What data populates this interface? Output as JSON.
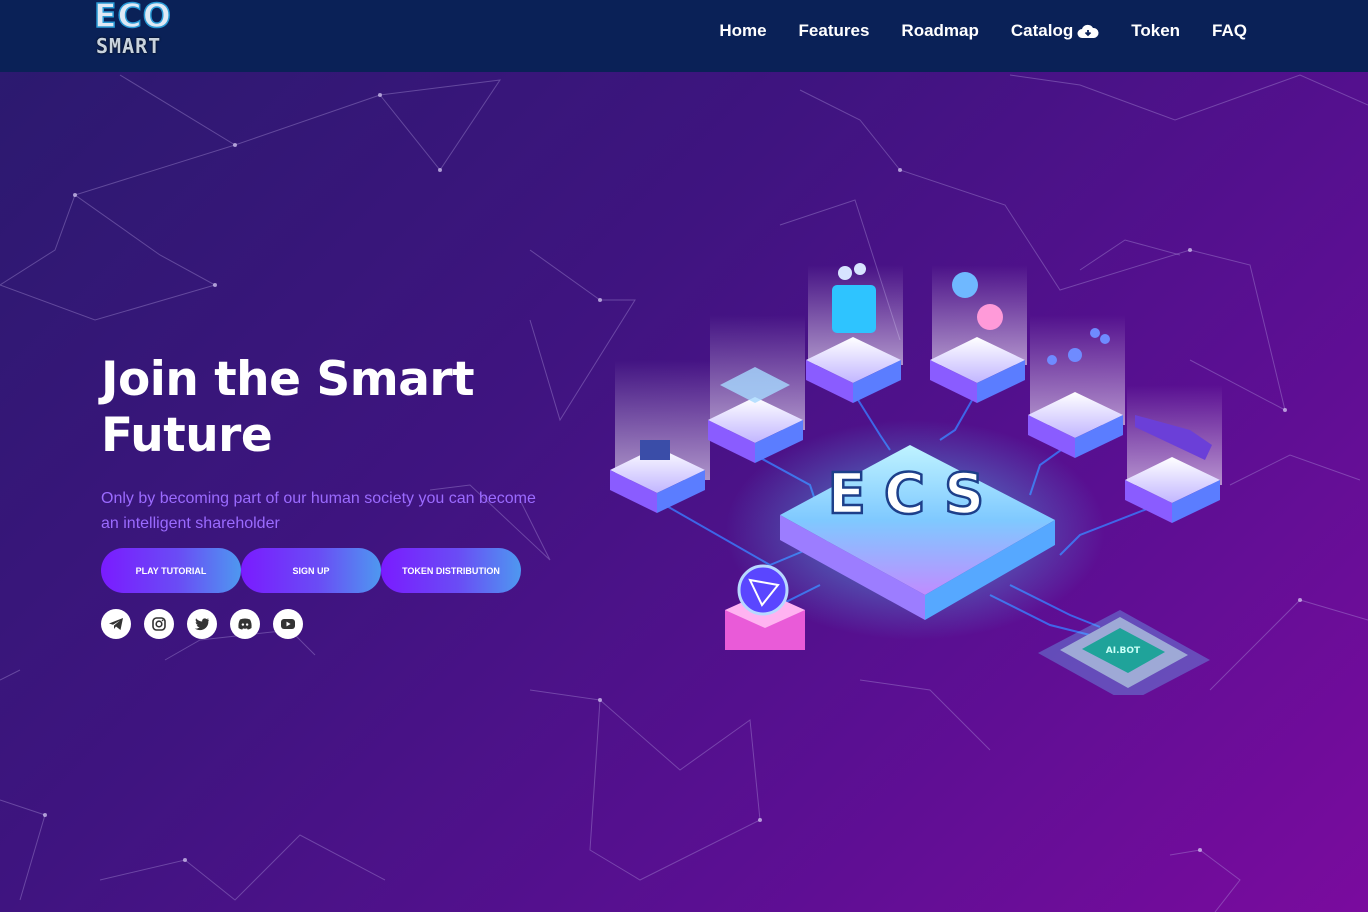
{
  "brand": {
    "logo_text_top": "ECO",
    "logo_text_bottom": "SMART"
  },
  "nav": {
    "items": [
      {
        "label": "Home"
      },
      {
        "label": "Features"
      },
      {
        "label": "Roadmap"
      },
      {
        "label": "Catalog",
        "icon": "cloud-download-icon"
      },
      {
        "label": "Token"
      },
      {
        "label": "FAQ"
      }
    ]
  },
  "hero": {
    "title_line1": "Join the Smart",
    "title_line2": "Future",
    "subtitle": "Only by becoming part of our human society you can become an intelligent shareholder",
    "buttons": [
      {
        "label": "PLAY TUTORIAL"
      },
      {
        "label": "SIGN UP"
      },
      {
        "label": "TOKEN DISTRIBUTION"
      }
    ]
  },
  "illustration": {
    "center_text": "ECS",
    "chip_text": "AI.BOT"
  },
  "socials": [
    {
      "icon": "telegram-icon"
    },
    {
      "icon": "instagram-icon"
    },
    {
      "icon": "twitter-icon"
    },
    {
      "icon": "discord-icon"
    },
    {
      "icon": "youtube-icon"
    }
  ],
  "colors": {
    "topbar": "#0a2157",
    "bg_start": "#2a1a6e",
    "bg_end": "#7a0b9e",
    "subtitle": "#9b6bff",
    "button_from": "#7a1bff",
    "button_to": "#4e98f0"
  }
}
